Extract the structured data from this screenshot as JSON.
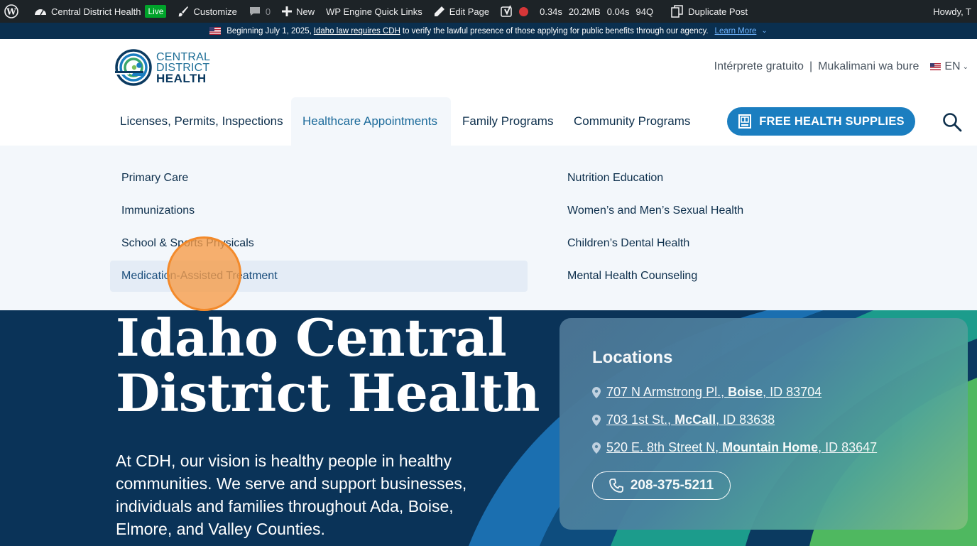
{
  "adminbar": {
    "site_name": "Central District Health",
    "live_badge": "Live",
    "customize": "Customize",
    "comments_count": "0",
    "new": "New",
    "wp_engine": "WP Engine Quick Links",
    "edit_page": "Edit Page",
    "stat_time": "0.34s",
    "stat_mem": "20.2MB",
    "stat_query_time": "0.04s",
    "stat_queries": "94Q",
    "duplicate_post": "Duplicate Post",
    "howdy": "Howdy, T"
  },
  "notice": {
    "text_before": "Beginning July 1, 2025,",
    "link_text": "Idaho law requires CDH",
    "text_after": "to verify the lawful presence of those applying for public benefits through our agency.",
    "learn_more": "Learn More"
  },
  "logo": {
    "line1": "CENTRAL",
    "line2": "DISTRICT",
    "line3": "HEALTH"
  },
  "utility": {
    "interpreter_es": "Intérprete gratuito",
    "separator": "|",
    "interpreter_sw": "Mukalimani wa bure",
    "language": "EN"
  },
  "nav": {
    "items": [
      {
        "label": "Licenses, Permits, Inspections"
      },
      {
        "label": "Healthcare Appointments"
      },
      {
        "label": "Family Programs"
      },
      {
        "label": "Community Programs"
      }
    ],
    "supplies_button": "FREE HEALTH SUPPLIES"
  },
  "mega_menu": {
    "left": [
      {
        "label": "Primary Care"
      },
      {
        "label": "Immunizations"
      },
      {
        "label": "School & Sports Physicals"
      },
      {
        "label": "Medication-Assisted Treatment"
      }
    ],
    "right": [
      {
        "label": "Nutrition Education"
      },
      {
        "label": "Women’s and Men’s Sexual Health"
      },
      {
        "label": "Children’s Dental Health"
      },
      {
        "label": "Mental Health Counseling"
      }
    ]
  },
  "hero": {
    "title_line1": "Idaho Central",
    "title_line2": "District Health",
    "body": "At CDH, our vision is healthy people in healthy communities. We serve and support businesses, individuals and families throughout Ada, Boise, Elmore, and Valley Counties."
  },
  "locations": {
    "title": "Locations",
    "items": [
      {
        "street": "707 N Armstrong Pl.,",
        "city": "Boise",
        "rest": ", ID 83704"
      },
      {
        "street": "703 1st St.,",
        "city": "McCall",
        "rest": ", ID 83638"
      },
      {
        "street": "520 E. 8th Street N,",
        "city": "Mountain Home",
        "rest": ", ID 83647"
      }
    ],
    "phone": "208-375-5211"
  },
  "colors": {
    "brand_blue": "#1b7ec0",
    "navy": "#0a3358",
    "nav_text": "#0d2f4c",
    "click_indicator": "#f38a2b"
  }
}
